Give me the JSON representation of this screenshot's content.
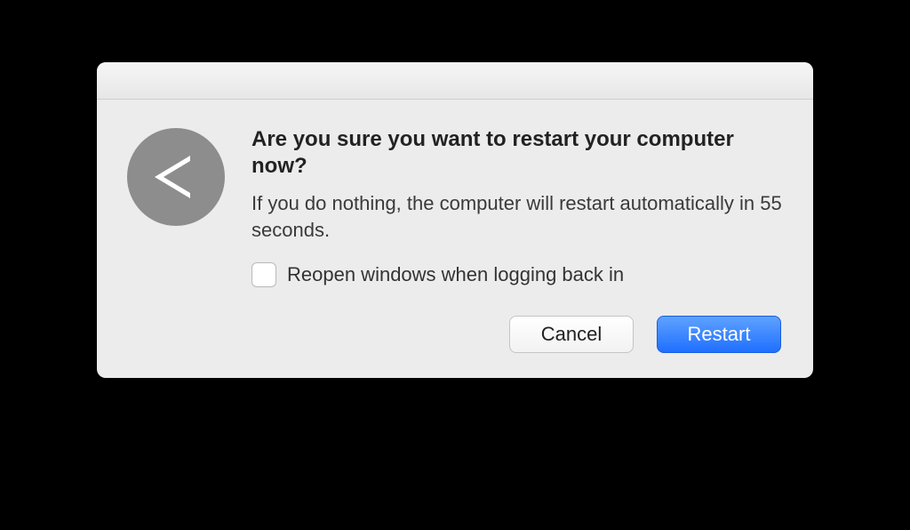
{
  "dialog": {
    "heading": "Are you sure you want to restart your computer now?",
    "subtext": "If you do nothing, the computer will restart automatically in 55 seconds.",
    "checkbox": {
      "label": "Reopen windows when logging back in",
      "checked": false
    },
    "buttons": {
      "cancel": "Cancel",
      "restart": "Restart"
    },
    "icon": "restart-arrow"
  }
}
